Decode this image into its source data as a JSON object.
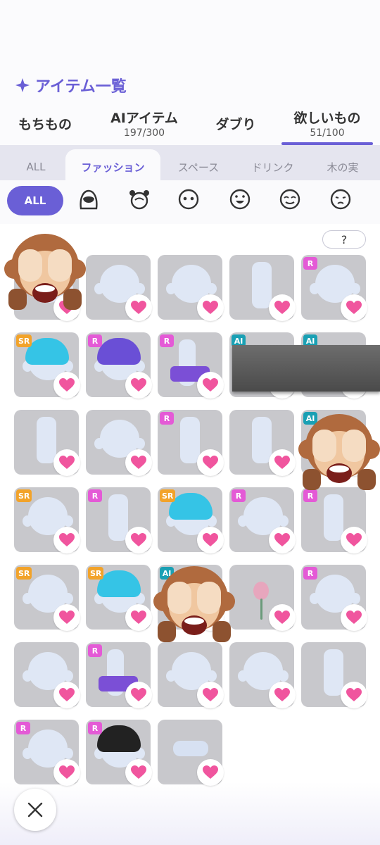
{
  "header": {
    "title": "アイテム一覧",
    "title_icon": "sparkle-icon",
    "accent": "#6a5fd6"
  },
  "main_tabs": [
    {
      "label": "もちもの",
      "count": ""
    },
    {
      "label": "AIアイテム",
      "count": "197/300"
    },
    {
      "label": "ダブり",
      "count": ""
    },
    {
      "label": "欲しいもの",
      "count": "51/100",
      "active": true
    }
  ],
  "category_tabs": [
    {
      "label": "ALL"
    },
    {
      "label": "ファッション",
      "active": true
    },
    {
      "label": "スペース"
    },
    {
      "label": "ドリンク"
    },
    {
      "label": "木の実"
    }
  ],
  "filters": {
    "all_label": "ALL",
    "icons": [
      "hair-icon",
      "head-accessory-icon",
      "eyes-icon",
      "mouth-icon",
      "closed-eyes-icon",
      "frown-face-icon"
    ]
  },
  "help": {
    "label": "?"
  },
  "items": [
    {
      "badge": "",
      "kind": "head"
    },
    {
      "badge": "",
      "kind": "head"
    },
    {
      "badge": "",
      "kind": "head"
    },
    {
      "badge": "",
      "kind": "outfit"
    },
    {
      "badge": "R",
      "kind": "head"
    },
    {
      "badge": "SR",
      "kind": "hair"
    },
    {
      "badge": "R",
      "kind": "hair"
    },
    {
      "badge": "R",
      "kind": "shoes"
    },
    {
      "badge": "AI",
      "kind": "hidden"
    },
    {
      "badge": "AI",
      "kind": "hidden"
    },
    {
      "badge": "",
      "kind": "outfit"
    },
    {
      "badge": "",
      "kind": "head"
    },
    {
      "badge": "R",
      "kind": "outfit"
    },
    {
      "badge": "",
      "kind": "outfit"
    },
    {
      "badge": "AI",
      "kind": "head"
    },
    {
      "badge": "SR",
      "kind": "head"
    },
    {
      "badge": "R",
      "kind": "outfit"
    },
    {
      "badge": "SR",
      "kind": "hair"
    },
    {
      "badge": "R",
      "kind": "head"
    },
    {
      "badge": "R",
      "kind": "outfit"
    },
    {
      "badge": "SR",
      "kind": "head"
    },
    {
      "badge": "SR",
      "kind": "hair"
    },
    {
      "badge": "AI",
      "kind": "head"
    },
    {
      "badge": "",
      "kind": "flower"
    },
    {
      "badge": "R",
      "kind": "head"
    },
    {
      "badge": "",
      "kind": "head"
    },
    {
      "badge": "R",
      "kind": "shoes"
    },
    {
      "badge": "",
      "kind": "head"
    },
    {
      "badge": "",
      "kind": "head"
    },
    {
      "badge": "",
      "kind": "outfit"
    },
    {
      "badge": "R",
      "kind": "head"
    },
    {
      "badge": "R",
      "kind": "hair"
    },
    {
      "badge": "",
      "kind": "ribbon"
    }
  ],
  "colors": {
    "heart": "#f0559e",
    "badge_r": "#e45ad6",
    "badge_sr": "#f2a32a",
    "badge_ai": "#1aa0b4"
  },
  "close": {
    "icon": "close-icon"
  }
}
